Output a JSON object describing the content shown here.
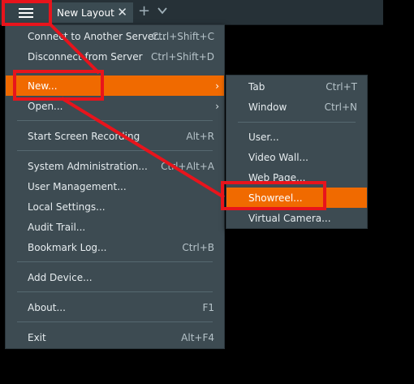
{
  "tabbar": {
    "tab_label": "New Layout",
    "close_glyph": "✕",
    "add_glyph": "+"
  },
  "main_menu": {
    "items": [
      {
        "label": "Connect to Another Server...",
        "shortcut": "Ctrl+Shift+C"
      },
      {
        "label": "Disconnect from Server",
        "shortcut": "Ctrl+Shift+D"
      },
      {
        "label": "New...",
        "shortcut": ""
      },
      {
        "label": "Open...",
        "shortcut": ""
      },
      {
        "label": "Start Screen Recording",
        "shortcut": "Alt+R"
      },
      {
        "label": "System Administration...",
        "shortcut": "Ctrl+Alt+A"
      },
      {
        "label": "User Management...",
        "shortcut": ""
      },
      {
        "label": "Local Settings...",
        "shortcut": ""
      },
      {
        "label": "Audit Trail...",
        "shortcut": ""
      },
      {
        "label": "Bookmark Log...",
        "shortcut": "Ctrl+B"
      },
      {
        "label": "Add Device...",
        "shortcut": ""
      },
      {
        "label": "About...",
        "shortcut": "F1"
      },
      {
        "label": "Exit",
        "shortcut": "Alt+F4"
      }
    ]
  },
  "sub_menu": {
    "items": [
      {
        "label": "Tab",
        "shortcut": "Ctrl+T"
      },
      {
        "label": "Window",
        "shortcut": "Ctrl+N"
      },
      {
        "label": "User...",
        "shortcut": ""
      },
      {
        "label": "Video Wall...",
        "shortcut": ""
      },
      {
        "label": "Web Page...",
        "shortcut": ""
      },
      {
        "label": "Showreel...",
        "shortcut": ""
      },
      {
        "label": "Virtual Camera...",
        "shortcut": ""
      }
    ]
  },
  "colors": {
    "highlight": "#f06a00",
    "menu_bg": "#3d4b52",
    "annotation": "#e8141c"
  },
  "icons": {
    "main_menu": "hamburger-icon",
    "submenu_arrow": "chevron-right-icon",
    "tab_more": "chevron-down-icon"
  }
}
